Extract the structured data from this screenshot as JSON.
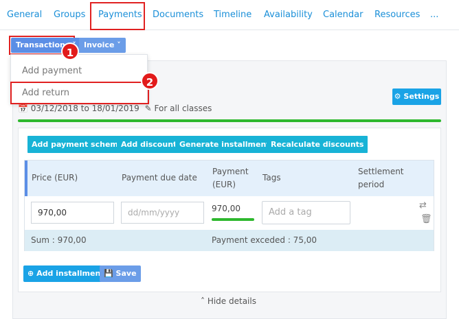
{
  "tabs": [
    {
      "label": "General"
    },
    {
      "label": "Groups"
    },
    {
      "label": "Payments"
    },
    {
      "label": "Documents"
    },
    {
      "label": "Timeline"
    },
    {
      "label": "Availability"
    },
    {
      "label": "Calendar"
    },
    {
      "label": "Resources"
    },
    {
      "label": "..."
    }
  ],
  "toolbar": {
    "transactions_label": "Transactions",
    "invoice_label": "Invoice"
  },
  "dropdown": {
    "items": [
      {
        "label": "Add payment"
      },
      {
        "label": "Add return"
      }
    ]
  },
  "annotations": {
    "step1": "1",
    "step2": "2",
    "highlight_color": "#e02020"
  },
  "panel": {
    "settings_label": "Settings",
    "date_from": "03/12/2018",
    "date_sep": "to",
    "date_to": "18/01/2019",
    "scope_label": "For all classes"
  },
  "actions": {
    "add_payment_scheme": "Add payment scheme",
    "add_discount": "Add discount",
    "generate_installments": "Generate installments",
    "recalculate_discounts": "Recalculate discounts"
  },
  "table": {
    "columns": [
      "Price (EUR)",
      "Payment due date",
      "Payment (EUR)",
      "Tags",
      "Settlement period"
    ],
    "row": {
      "price": "970,00",
      "due_date_placeholder": "dd/mm/yyyy",
      "payment": "970,00",
      "payment_progress": 1.0,
      "tag_placeholder": "Add a tag"
    },
    "sum_label": "Sum : 970,00",
    "exceeded_label": "Payment exceded : 75,00"
  },
  "footer": {
    "add_installment_label": "Add installment",
    "save_label": "Save",
    "hide_details_label": "Hide details"
  },
  "colors": {
    "accent": "#1a8fd8",
    "cyan": "#18b3d6",
    "green": "#2eb82e",
    "red": "#e02020"
  }
}
